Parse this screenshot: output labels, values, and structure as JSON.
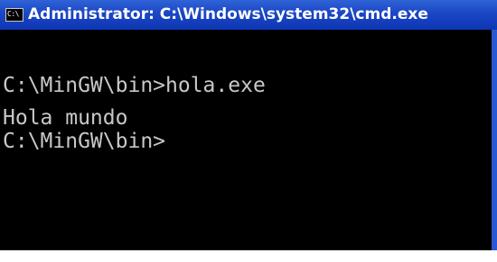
{
  "window": {
    "title": "Administrator: C:\\Windows\\system32\\cmd.exe",
    "icon": "cmd-icon",
    "icon_glyph": "C:\\",
    "title_color": "#1b46c4",
    "console_bg": "#000000",
    "console_text_color": "#c8c8c8"
  },
  "console": {
    "lines": [
      "C:\\MinGW\\bin>hola.exe",
      "Hola mundo",
      "C:\\MinGW\\bin>"
    ]
  }
}
